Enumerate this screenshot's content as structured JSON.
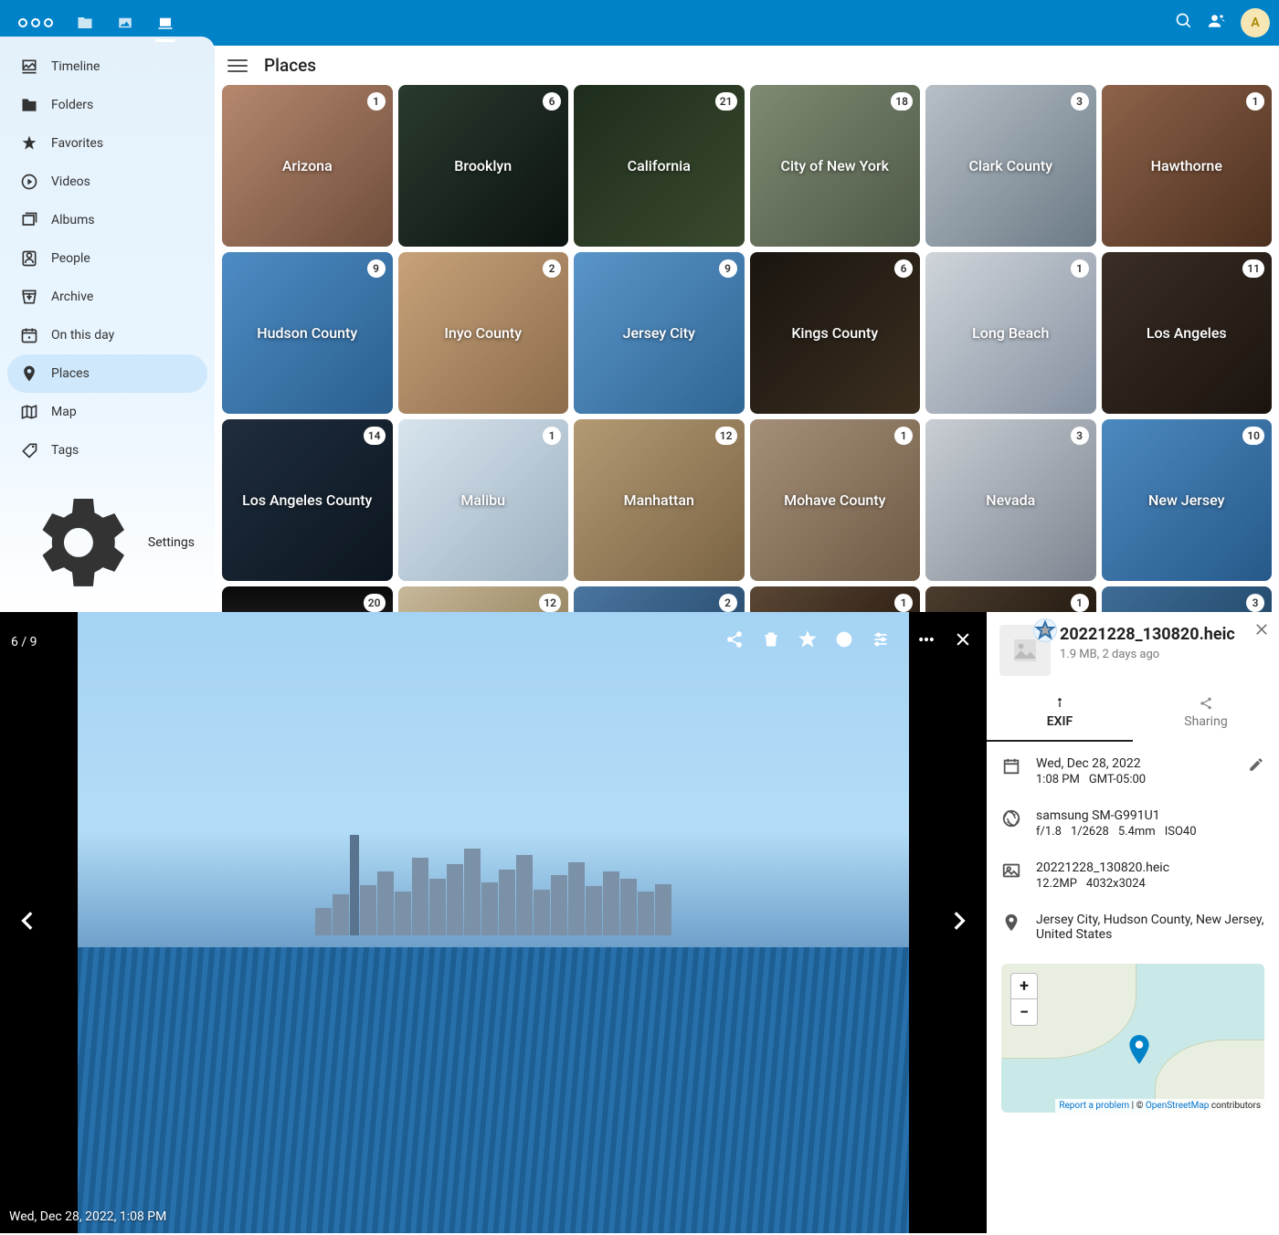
{
  "avatar_letter": "A",
  "sidebar": {
    "items": [
      {
        "label": "Timeline"
      },
      {
        "label": "Folders"
      },
      {
        "label": "Favorites"
      },
      {
        "label": "Videos"
      },
      {
        "label": "Albums"
      },
      {
        "label": "People"
      },
      {
        "label": "Archive"
      },
      {
        "label": "On this day"
      },
      {
        "label": "Places"
      },
      {
        "label": "Map"
      },
      {
        "label": "Tags"
      }
    ],
    "settings_label": "Settings"
  },
  "page_title": "Places",
  "places": [
    {
      "name": "Arizona",
      "count": 1,
      "bg": "linear-gradient(135deg,#b6886f,#6e4d3a)"
    },
    {
      "name": "Brooklyn",
      "count": 6,
      "bg": "linear-gradient(135deg,#2a3a2e,#0c1310)"
    },
    {
      "name": "California",
      "count": 21,
      "bg": "linear-gradient(135deg,#1e2d1c,#3a4a2e)"
    },
    {
      "name": "City of New York",
      "count": 18,
      "bg": "linear-gradient(135deg,#7e8a73,#4e5846)"
    },
    {
      "name": "Clark County",
      "count": 3,
      "bg": "linear-gradient(135deg,#b7bfc6,#6b7a86)"
    },
    {
      "name": "Hawthorne",
      "count": 1,
      "bg": "linear-gradient(135deg,#8e634a,#4b2f1e)"
    },
    {
      "name": "Hudson County",
      "count": 9,
      "bg": "linear-gradient(135deg,#4d8cc4,#2a5f8f)"
    },
    {
      "name": "Inyo County",
      "count": 2,
      "bg": "linear-gradient(135deg,#c7a27a,#8d6c4b)"
    },
    {
      "name": "Jersey City",
      "count": 9,
      "bg": "linear-gradient(135deg,#5a95c9,#2f6694)"
    },
    {
      "name": "Kings County",
      "count": 6,
      "bg": "linear-gradient(135deg,#1a1510,#3a2e1f)"
    },
    {
      "name": "Long Beach",
      "count": 1,
      "bg": "linear-gradient(135deg,#cfd5da,#8590a0)"
    },
    {
      "name": "Los Angeles",
      "count": 11,
      "bg": "linear-gradient(135deg,#3a2e26,#1b140e)"
    },
    {
      "name": "Los Angeles County",
      "count": 14,
      "bg": "linear-gradient(135deg,#1f2d3d,#0c1620)"
    },
    {
      "name": "Malibu",
      "count": 1,
      "bg": "linear-gradient(135deg,#d7e4ee,#9db0bf)"
    },
    {
      "name": "Manhattan",
      "count": 12,
      "bg": "linear-gradient(135deg,#b39a74,#7a6344)"
    },
    {
      "name": "Mohave County",
      "count": 1,
      "bg": "linear-gradient(135deg,#a58f78,#6e5a45)"
    },
    {
      "name": "Nevada",
      "count": 3,
      "bg": "linear-gradient(135deg,#c9ced4,#7d8590)"
    },
    {
      "name": "New Jersey",
      "count": 10,
      "bg": "linear-gradient(135deg,#4c89bf,#26598a)"
    },
    {
      "name": "",
      "count": 20,
      "bg": "linear-gradient(180deg,#0a0a0a,#1a1a1a)"
    },
    {
      "name": "",
      "count": 12,
      "bg": "linear-gradient(135deg,#c7b89a,#9a8864)"
    },
    {
      "name": "",
      "count": 2,
      "bg": "linear-gradient(135deg,#4a76a0,#2b4f72)"
    },
    {
      "name": "",
      "count": 1,
      "bg": "linear-gradient(135deg,#5b4735,#2e2015)"
    },
    {
      "name": "",
      "count": 1,
      "bg": "linear-gradient(135deg,#4b3d2f,#241a10)"
    },
    {
      "name": "",
      "count": 3,
      "bg": "linear-gradient(135deg,#3f6d97,#234a6c)"
    }
  ],
  "viewer": {
    "counter": "6 / 9",
    "timestamp_overlay": "Wed, Dec 28, 2022, 1:08 PM"
  },
  "details": {
    "filename": "20221228_130820.heic",
    "filesize_line": "1.9 MB, 2 days ago",
    "tabs": {
      "exif": "EXIF",
      "sharing": "Sharing"
    },
    "date": {
      "l1": "Wed, Dec 28, 2022",
      "l2a": "1:08 PM",
      "l2b": "GMT-05:00"
    },
    "camera": {
      "l1": "samsung SM-G991U1",
      "l2a": "f/1.8",
      "l2b": "1/2628",
      "l2c": "5.4mm",
      "l2d": "ISO40"
    },
    "image": {
      "l1": "20221228_130820.heic",
      "l2a": "12.2MP",
      "l2b": "4032x3024"
    },
    "location": {
      "l1": "Jersey City, Hudson County, New Jersey, United States"
    },
    "map_attr": {
      "report": "Report a problem",
      "copy": "| © ",
      "osm": "OpenStreetMap",
      "tail": " contributors"
    }
  }
}
